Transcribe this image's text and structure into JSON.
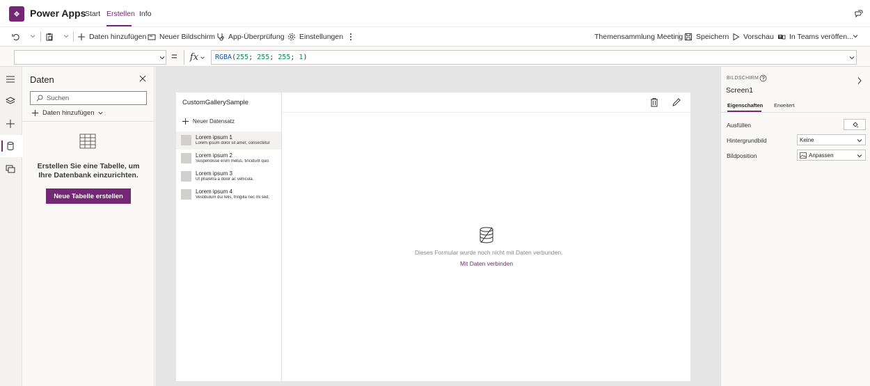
{
  "header": {
    "app_name": "Power Apps",
    "tabs": [
      {
        "label": "Start",
        "active": false
      },
      {
        "label": "Erstellen",
        "active": true
      },
      {
        "label": "Info",
        "active": false
      }
    ],
    "accent_color": "#742774"
  },
  "toolbar": {
    "add_data": "Daten hinzufügen",
    "new_screen": "Neuer Bildschirm",
    "app_check": "App-Überprüfung",
    "settings": "Einstellungen",
    "app_name_label": "Themensammlung Meeting",
    "save": "Speichern",
    "preview": "Vorschau",
    "publish_teams": "In Teams veröffen..."
  },
  "formula_bar": {
    "property": "",
    "equals": "=",
    "fx": "fx",
    "formula": {
      "fn": "RGBA",
      "args": [
        "255",
        "255",
        "255",
        "1"
      ]
    }
  },
  "data_panel": {
    "title": "Daten",
    "search_placeholder": "Suchen",
    "add_data": "Daten hinzufügen",
    "empty_message": "Erstellen Sie eine Tabelle, um Ihre Datenbank einzurichten.",
    "new_table_button": "Neue Tabelle erstellen"
  },
  "canvas": {
    "gallery_title": "CustomGallerySample",
    "new_record": "Neuer Datensatz",
    "items": [
      {
        "title": "Lorem ipsum 1",
        "subtitle": "Lorem ipsum dolor sit amet, consectetur",
        "selected": true
      },
      {
        "title": "Lorem ipsum 2",
        "subtitle": "Suspendisse enim metus, tincidunt quis",
        "selected": false
      },
      {
        "title": "Lorem ipsum 3",
        "subtitle": "Ut pharetra a dolor ac vehicula.",
        "selected": false
      },
      {
        "title": "Lorem ipsum 4",
        "subtitle": "Vestibulum dui felis, fringilla nec mi sed,",
        "selected": false
      }
    ],
    "form_message": "Dieses Formular wurde noch nicht mit Daten verbunden.",
    "form_link": "Mit Daten verbinden"
  },
  "properties_panel": {
    "kind": "BILDSCHIRM",
    "name": "Screen1",
    "tabs": [
      "Eigenschaften",
      "Erweitert"
    ],
    "fill_label": "Ausfüllen",
    "bg_image_label": "Hintergrundbild",
    "bg_image_value": "Keine",
    "image_position_label": "Bildposition",
    "image_position_value": "Anpassen"
  }
}
